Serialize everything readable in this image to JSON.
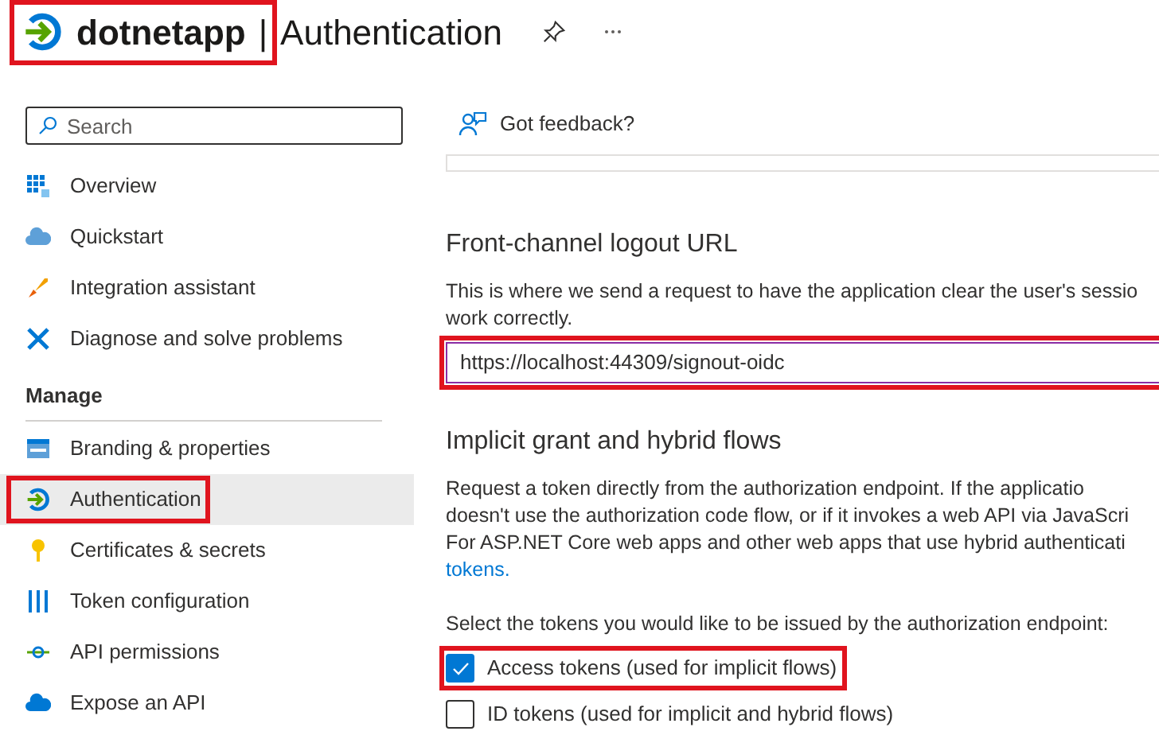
{
  "header": {
    "app_name": "dotnetapp",
    "separator": "|",
    "page_title": "Authentication",
    "highlighted": true
  },
  "sidebar": {
    "search": {
      "placeholder": "Search"
    },
    "items": [
      {
        "label": "Overview",
        "selected": false,
        "highlighted": false
      },
      {
        "label": "Quickstart",
        "selected": false,
        "highlighted": false
      },
      {
        "label": "Integration assistant",
        "selected": false,
        "highlighted": false
      },
      {
        "label": "Diagnose and solve problems",
        "selected": false,
        "highlighted": false
      }
    ],
    "section_title": "Manage",
    "manage_items": [
      {
        "label": "Branding & properties",
        "selected": false,
        "highlighted": false
      },
      {
        "label": "Authentication",
        "selected": true,
        "highlighted": true
      },
      {
        "label": "Certificates & secrets",
        "selected": false,
        "highlighted": false
      },
      {
        "label": "Token configuration",
        "selected": false,
        "highlighted": false
      },
      {
        "label": "API permissions",
        "selected": false,
        "highlighted": false
      },
      {
        "label": "Expose an API",
        "selected": false,
        "highlighted": false
      }
    ]
  },
  "toolbar": {
    "feedback": "Got feedback?"
  },
  "logout": {
    "title": "Front-channel logout URL",
    "description": [
      "This is where we send a request to have the application clear the user's sessio",
      "work correctly."
    ],
    "value": "https://localhost:44309/signout-oidc",
    "highlighted": true
  },
  "implicit": {
    "title": "Implicit grant and hybrid flows",
    "description": [
      "Request a token directly from the authorization endpoint. If the applicatio",
      "doesn't use the authorization code flow, or if it invokes a web API via JavaScri",
      "For ASP.NET Core web apps and other web apps that use hybrid authenticati"
    ],
    "link": "tokens.",
    "prompt": "Select the tokens you would like to be issued by the authorization endpoint:",
    "options": [
      {
        "label": "Access tokens (used for implicit flows)",
        "checked": true,
        "highlighted": true
      },
      {
        "label": "ID tokens (used for implicit and hybrid flows)",
        "checked": false,
        "highlighted": false
      }
    ]
  }
}
